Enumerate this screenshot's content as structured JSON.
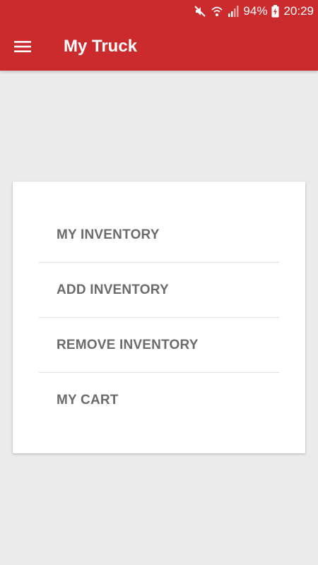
{
  "status_bar": {
    "battery_text": "94%",
    "time": "20:29",
    "icons": [
      "mute-icon",
      "wifi-icon",
      "signal-icon",
      "battery-charging-icon"
    ]
  },
  "app_bar": {
    "menu_icon": "hamburger-menu-icon",
    "title": "My Truck",
    "color": "#cc2b2e"
  },
  "menu": {
    "items": [
      {
        "label": "MY INVENTORY"
      },
      {
        "label": "ADD INVENTORY"
      },
      {
        "label": "REMOVE INVENTORY"
      },
      {
        "label": "MY CART"
      }
    ],
    "text_color": "#6b6b6b"
  }
}
